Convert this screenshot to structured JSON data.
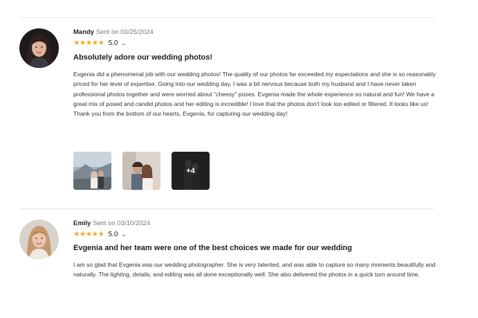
{
  "reviews": [
    {
      "name": "Mandy",
      "sent": "Sent on 03/25/2024",
      "stars": "★★★★★",
      "rating": "5.0",
      "title": "Absolutely adore our wedding photos!",
      "body": "Evgenia did a phenomenal job with our wedding photos! The quality of our photos far exceeded my expectations and she is so reasonably priced for her level of expertise. Going into our wedding day, I was a bit nervous because both my husband and I have never taken professional photos together and were worried about \"cheesy\" poses. Evgenia made the whole experience so natural and fun! We have a great mix of posed and candid photos and her editing is incredible! I love that the photos don't look too edited or filtered. It looks like us! Thank you from the bottom of our hearts, Evgenia, for capturing our wedding day!",
      "more_photos_label": "+4"
    },
    {
      "name": "Emily",
      "sent": "Sent on 03/10/2024",
      "stars": "★★★★★",
      "rating": "5.0",
      "title": "Evgenia and her team were one of the best choices we made for our wedding",
      "body": "I am so glad that Evgenia was our wedding photographer. She is very talented, and was able to capture so many moments beautifully and naturally. The lighting, details, and editing was all done exceptionally well. She also delivered the photos in a quick turn around time."
    }
  ],
  "colors": {
    "star": "#f4a81d",
    "divider": "#e6e6e6"
  },
  "icons": {
    "expand": "chevron-down-icon",
    "star": "star-icon"
  }
}
